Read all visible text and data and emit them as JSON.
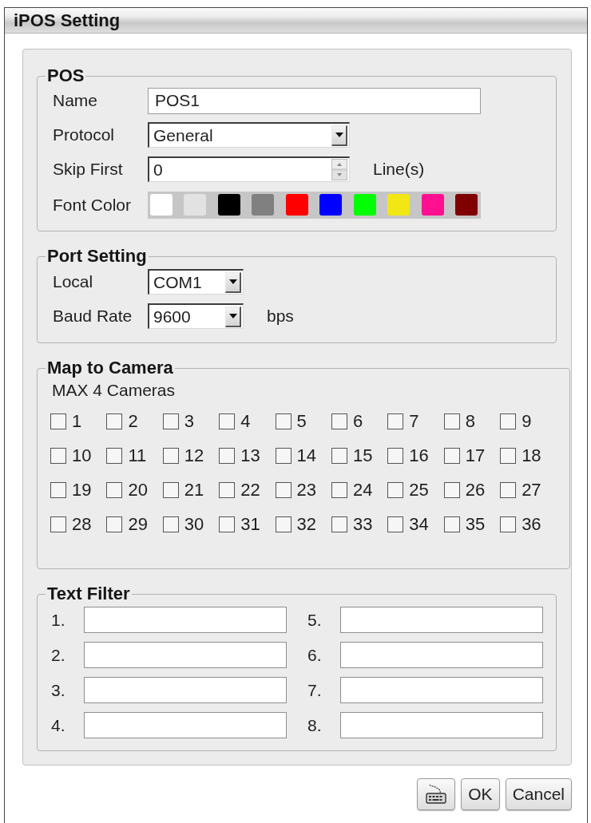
{
  "window": {
    "title": "iPOS Setting"
  },
  "pos": {
    "legend": "POS",
    "fields": [
      {
        "kind": "text",
        "label": "Name",
        "value": "POS1"
      },
      {
        "kind": "dropdown",
        "label": "Protocol",
        "value": "General"
      },
      {
        "kind": "spinner",
        "label": "Skip First",
        "value": "0",
        "unit": "Line(s)"
      },
      {
        "kind": "colors",
        "label": "Font Color",
        "swatches": [
          {
            "color": "#ffffff"
          },
          {
            "color": "#e2e2e2"
          },
          {
            "color": "#000000"
          },
          {
            "color": "#808080"
          },
          {
            "color": "#ff0000"
          },
          {
            "color": "#0000ff"
          },
          {
            "color": "#00ff00"
          },
          {
            "color": "#f2e614"
          },
          {
            "color": "#ff1090"
          },
          {
            "color": "#800000"
          }
        ]
      }
    ]
  },
  "port_setting": {
    "legend": "Port Setting",
    "fields": [
      {
        "kind": "dropdown",
        "label": "Local",
        "value": "COM1"
      },
      {
        "kind": "dropdown",
        "label": "Baud Rate",
        "value": "9600",
        "unit": "bps"
      }
    ]
  },
  "map_to_camera": {
    "legend": "Map to Camera",
    "note": "MAX 4 Cameras",
    "cameras": [
      {
        "label": "1",
        "checked": false
      },
      {
        "label": "2",
        "checked": false
      },
      {
        "label": "3",
        "checked": false
      },
      {
        "label": "4",
        "checked": false
      },
      {
        "label": "5",
        "checked": false
      },
      {
        "label": "6",
        "checked": false
      },
      {
        "label": "7",
        "checked": false
      },
      {
        "label": "8",
        "checked": false
      },
      {
        "label": "9",
        "checked": false
      },
      {
        "label": "10",
        "checked": false
      },
      {
        "label": "11",
        "checked": false
      },
      {
        "label": "12",
        "checked": false
      },
      {
        "label": "13",
        "checked": false
      },
      {
        "label": "14",
        "checked": false
      },
      {
        "label": "15",
        "checked": false
      },
      {
        "label": "16",
        "checked": false
      },
      {
        "label": "17",
        "checked": false
      },
      {
        "label": "18",
        "checked": false
      },
      {
        "label": "19",
        "checked": false
      },
      {
        "label": "20",
        "checked": false
      },
      {
        "label": "21",
        "checked": false
      },
      {
        "label": "22",
        "checked": false
      },
      {
        "label": "23",
        "checked": false
      },
      {
        "label": "24",
        "checked": false
      },
      {
        "label": "25",
        "checked": false
      },
      {
        "label": "26",
        "checked": false
      },
      {
        "label": "27",
        "checked": false
      },
      {
        "label": "28",
        "checked": false
      },
      {
        "label": "29",
        "checked": false
      },
      {
        "label": "30",
        "checked": false
      },
      {
        "label": "31",
        "checked": false
      },
      {
        "label": "32",
        "checked": false
      },
      {
        "label": "33",
        "checked": false
      },
      {
        "label": "34",
        "checked": false
      },
      {
        "label": "35",
        "checked": false
      },
      {
        "label": "36",
        "checked": false
      }
    ]
  },
  "text_filter": {
    "legend": "Text Filter",
    "filters": [
      {
        "label": "1."
      },
      {
        "label": "2."
      },
      {
        "label": "3."
      },
      {
        "label": "4."
      },
      {
        "label": "5."
      },
      {
        "label": "6."
      },
      {
        "label": "7."
      },
      {
        "label": "8."
      }
    ]
  },
  "buttons": [
    {
      "kind": "keyboard"
    },
    {
      "kind": "text",
      "label": "OK"
    },
    {
      "kind": "text",
      "label": "Cancel"
    }
  ]
}
